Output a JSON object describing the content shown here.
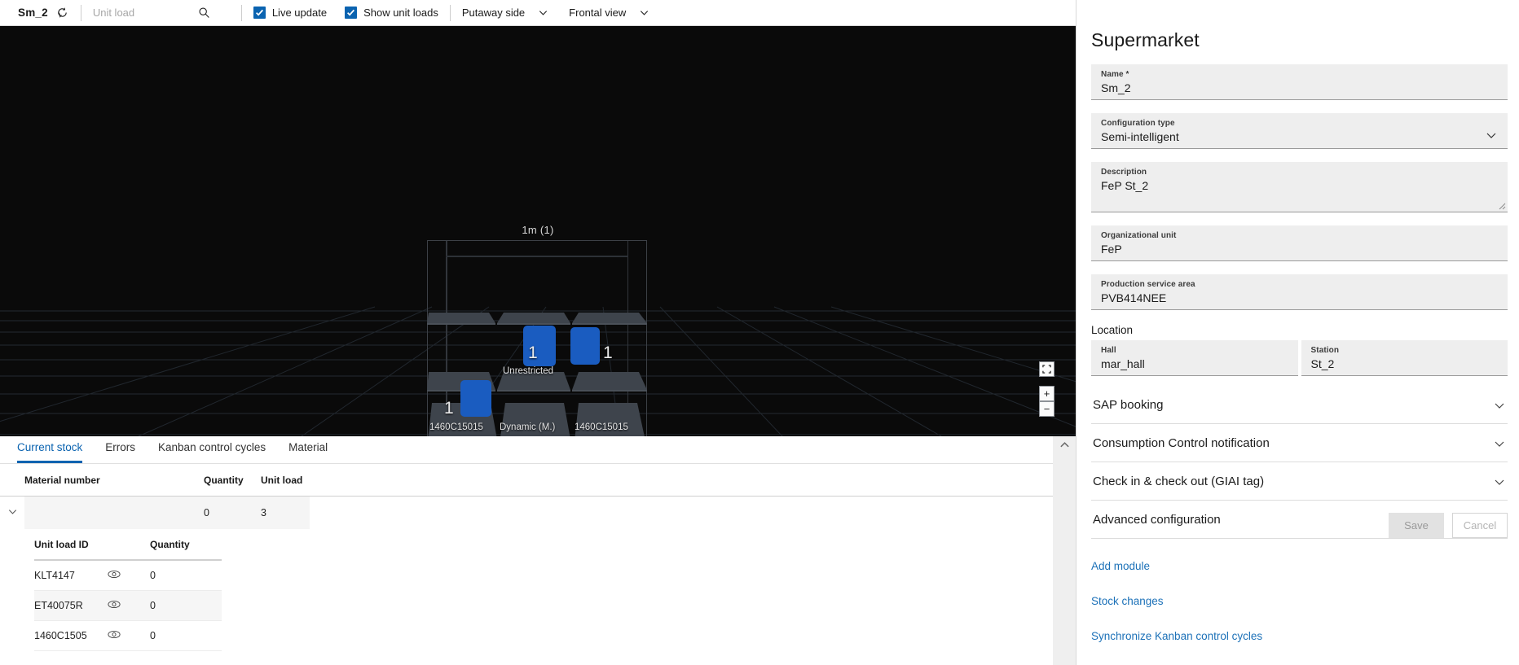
{
  "toolbar": {
    "title": "Sm_2",
    "refresh_icon": "refresh-icon",
    "search_placeholder": "Unit load",
    "search_value": "",
    "search_icon": "search-icon",
    "checkboxes": [
      {
        "label": "Live update",
        "checked": true
      },
      {
        "label": "Show unit loads",
        "checked": true
      }
    ],
    "dropdowns": [
      {
        "label": "Putaway side"
      },
      {
        "label": "Frontal view"
      }
    ],
    "accent": "#0a63b0"
  },
  "viewport": {
    "rack_label": "1m (1)",
    "background": "#0a0a0a",
    "bin_color": "#1a5cc0",
    "shelf_color": "#3e444c",
    "status_bar_color": "#62d13a",
    "shelves": [
      {
        "row": "top",
        "col": "left",
        "caption": "",
        "qty": ""
      },
      {
        "row": "top",
        "col": "center",
        "caption": "",
        "qty": ""
      },
      {
        "row": "top",
        "col": "right",
        "caption": "",
        "qty": ""
      },
      {
        "row": "middle",
        "col": "left",
        "caption": "",
        "qty": ""
      },
      {
        "row": "middle",
        "col": "center",
        "caption": "Unrestricted",
        "qty": "1"
      },
      {
        "row": "middle",
        "col": "right",
        "caption": "",
        "qty": "1"
      },
      {
        "row": "bottom",
        "col": "left",
        "caption": "1460C15015",
        "qty": "1"
      },
      {
        "row": "bottom",
        "col": "center",
        "caption": "Dynamic (M.)",
        "qty": ""
      },
      {
        "row": "bottom",
        "col": "right",
        "caption": "1460C15015",
        "qty": ""
      }
    ],
    "controls": {
      "fit_icon": "fit-to-screen-icon",
      "zoom_in": "+",
      "zoom_out": "−"
    }
  },
  "bottom": {
    "tabs": [
      {
        "label": "Current stock",
        "active": true
      },
      {
        "label": "Errors",
        "active": false
      },
      {
        "label": "Kanban control cycles",
        "active": false
      },
      {
        "label": "Material",
        "active": false
      }
    ],
    "collapse_icon": "chevron-up-icon",
    "table": {
      "columns": [
        "Material number",
        "Quantity",
        "Unit load"
      ],
      "rows": [
        {
          "expand_icon": "chevron-down-icon",
          "material_number": "",
          "quantity": "0",
          "unit_load": "3"
        }
      ],
      "sub_table": {
        "columns": [
          "Unit load ID",
          "Quantity"
        ],
        "eye_icon": "eye-icon",
        "rows": [
          {
            "unit_load_id": "KLT4147",
            "quantity": "0"
          },
          {
            "unit_load_id": "ET40075R",
            "quantity": "0"
          },
          {
            "unit_load_id": "1460C1505",
            "quantity": "0"
          }
        ]
      }
    }
  },
  "panel": {
    "title": "Supermarket",
    "fields": {
      "name": {
        "label": "Name *",
        "value": "Sm_2"
      },
      "config_type": {
        "label": "Configuration type",
        "value": "Semi-intelligent",
        "chevron": "chevron-down-icon"
      },
      "description": {
        "label": "Description",
        "value": "FeP St_2"
      },
      "org_unit": {
        "label": "Organizational unit",
        "value": "FeP"
      },
      "psa": {
        "label": "Production service area",
        "value": "PVB414NEE"
      }
    },
    "location": {
      "section_label": "Location",
      "hall": {
        "label": "Hall",
        "value": "mar_hall"
      },
      "station": {
        "label": "Station",
        "value": "St_2"
      }
    },
    "accordions": [
      {
        "label": "SAP booking",
        "chevron": "chevron-down-icon"
      },
      {
        "label": "Consumption Control notification",
        "chevron": "chevron-down-icon"
      },
      {
        "label": "Check in & check out (GIAI tag)",
        "chevron": "chevron-down-icon"
      },
      {
        "label": "Advanced configuration",
        "chevron": "chevron-down-icon"
      }
    ],
    "links": [
      {
        "label": "Add module"
      },
      {
        "label": "Stock changes"
      },
      {
        "label": "Synchronize Kanban control cycles"
      }
    ],
    "buttons": {
      "save": "Save",
      "cancel": "Cancel"
    },
    "link_color": "#1c71b8"
  }
}
